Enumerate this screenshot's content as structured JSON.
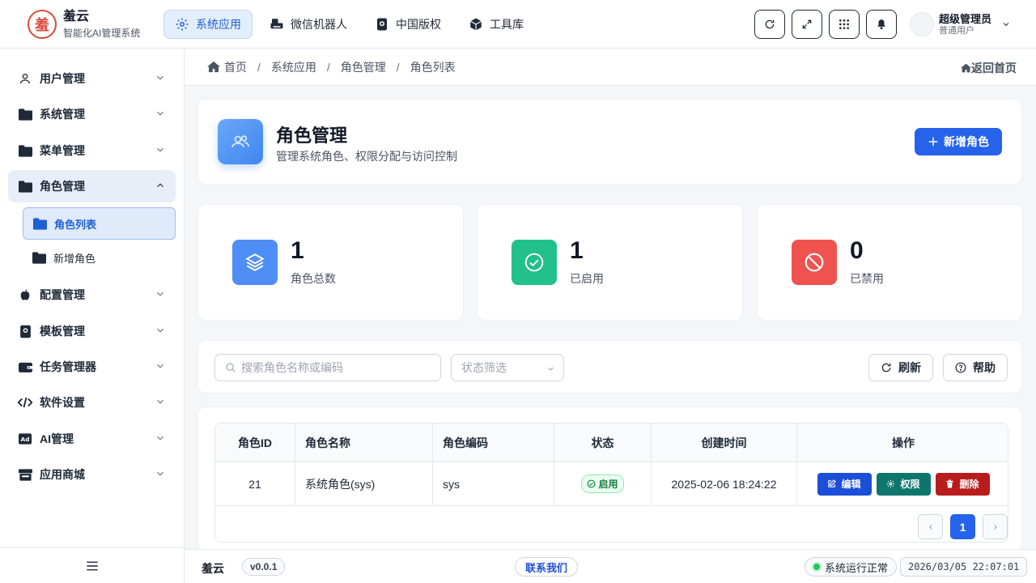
{
  "brand": {
    "name": "羞云",
    "subtitle": "智能化AI管理系统",
    "logo_char": "羞"
  },
  "topnav": [
    {
      "label": "系统应用",
      "icon": "gear-icon",
      "active": true
    },
    {
      "label": "微信机器人",
      "icon": "printer-icon",
      "active": false
    },
    {
      "label": "中国版权",
      "icon": "copyright-icon",
      "active": false
    },
    {
      "label": "工具库",
      "icon": "cube-icon",
      "active": false
    }
  ],
  "user": {
    "name": "超级管理员",
    "role": "普通用户"
  },
  "sidebar": {
    "items": [
      {
        "label": "用户管理",
        "icon": "user-icon"
      },
      {
        "label": "系统管理",
        "icon": "folder-icon"
      },
      {
        "label": "菜单管理",
        "icon": "folder-icon"
      },
      {
        "label": "角色管理",
        "icon": "folder-icon",
        "open": true
      },
      {
        "label": "配置管理",
        "icon": "apple-icon"
      },
      {
        "label": "模板管理",
        "icon": "book-icon"
      },
      {
        "label": "任务管理器",
        "icon": "wallet-icon"
      },
      {
        "label": "软件设置",
        "icon": "code-icon"
      },
      {
        "label": "AI管理",
        "icon": "ad-icon"
      },
      {
        "label": "应用商城",
        "icon": "store-icon"
      }
    ],
    "subitems": [
      {
        "label": "角色列表",
        "active": true
      },
      {
        "label": "新增角色",
        "active": false
      }
    ]
  },
  "breadcrumb": [
    "首页",
    "系统应用",
    "角色管理",
    "角色列表"
  ],
  "back_home": "返回首页",
  "header": {
    "title": "角色管理",
    "subtitle": "管理系统角色、权限分配与访问控制",
    "add_button": "新增角色"
  },
  "stats": [
    {
      "value": "1",
      "label": "角色总数",
      "color": "#4f8ef5",
      "icon": "layers-icon"
    },
    {
      "value": "1",
      "label": "已启用",
      "color": "#22c08a",
      "icon": "check-circle-icon"
    },
    {
      "value": "0",
      "label": "已禁用",
      "color": "#ef5350",
      "icon": "ban-icon"
    }
  ],
  "filters": {
    "search_placeholder": "搜索角色名称或编码",
    "status_placeholder": "状态筛选",
    "refresh": "刷新",
    "help": "帮助"
  },
  "table": {
    "headers": [
      "角色ID",
      "角色名称",
      "角色编码",
      "状态",
      "创建时间",
      "操作"
    ],
    "rows": [
      {
        "id": "21",
        "name": "系统角色(sys)",
        "code": "sys",
        "status": "启用",
        "created": "2025-02-06 18:24:22"
      }
    ],
    "actions": {
      "edit": "编辑",
      "perm": "权限",
      "delete": "删除"
    },
    "page": "1"
  },
  "footer": {
    "name": "羞云",
    "version": "v0.0.1",
    "contact": "联系我们",
    "status": "系统运行正常",
    "time": "2026/03/05 22:07:01"
  },
  "colors": {
    "primary": "#2563eb",
    "edit": "#1d4ed8",
    "perm": "#0f766e",
    "delete": "#b91c1c"
  }
}
